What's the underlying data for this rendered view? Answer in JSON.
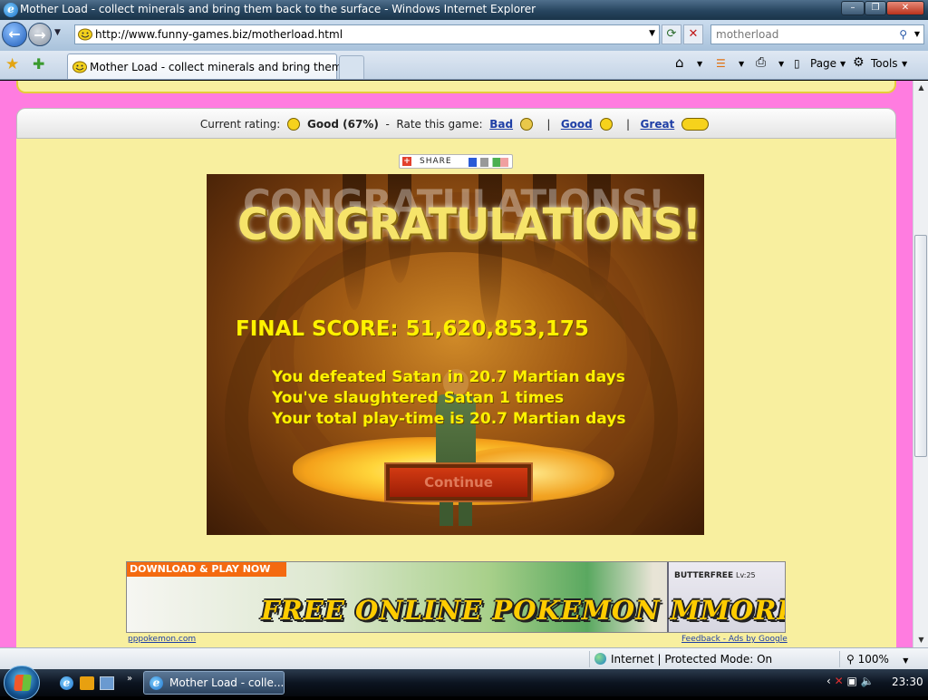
{
  "window": {
    "title": "Mother Load - collect minerals and bring them back to the surface - Windows Internet Explorer",
    "minimize": "–",
    "maximize": "❐",
    "close": "✕"
  },
  "address_bar": {
    "url": "http://www.funny-games.biz/motherload.html"
  },
  "search": {
    "value": "motherload"
  },
  "tabs": [
    {
      "label": "Mother Load - collect minerals and bring them b..."
    }
  ],
  "command_bar": {
    "page": "Page",
    "tools": "Tools"
  },
  "rating": {
    "current_label": "Current rating:",
    "current_value": "Good (67%)",
    "separator": "-",
    "rate_label": "Rate this game:",
    "bad": "Bad",
    "good": "Good",
    "great": "Great",
    "pipe": "|"
  },
  "share": {
    "label": "SHARE"
  },
  "game": {
    "headline": "CONGRATULATIONS!",
    "final_score": "FINAL SCORE: 51,620,853,175",
    "stats": [
      "You defeated Satan in 20.7 Martian days",
      "You've slaughtered Satan 1 times",
      "Your total play-time is 20.7 Martian days"
    ],
    "continue": "Continue"
  },
  "ad": {
    "badge": "DOWNLOAD & PLAY NOW",
    "headline": "FREE ONLINE POKEMON MMORPG!",
    "pokemon_name": "BUTTERFREE",
    "level": "Lv:25",
    "source_link": "pppokemon.com",
    "feedback": "Feedback - Ads by Google"
  },
  "status_bar": {
    "zone": "Internet | Protected Mode: On",
    "zoom": "100%"
  },
  "taskbar": {
    "task_label": "Mother Load - colle...",
    "clock": "23:30"
  }
}
